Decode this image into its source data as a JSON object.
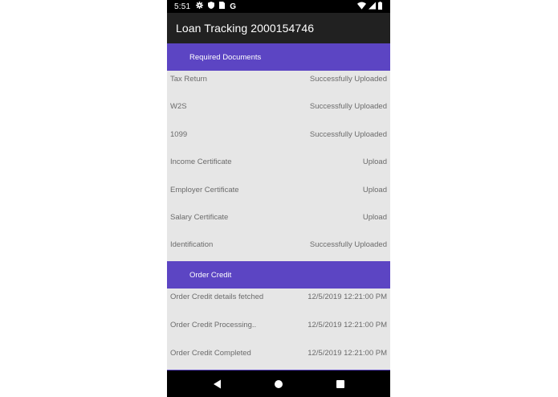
{
  "status_bar": {
    "time": "5:51",
    "icons_left": [
      "gear-icon",
      "shield-icon",
      "sim-icon",
      "google-icon"
    ],
    "icons_right": [
      "wifi-icon",
      "signal-icon",
      "battery-icon"
    ],
    "google_glyph": "G"
  },
  "app_bar": {
    "title": "Loan Tracking 2000154746"
  },
  "sections": [
    {
      "header": "Required Documents",
      "rows": [
        {
          "label": "Tax Return",
          "value": "Successfully Uploaded"
        },
        {
          "label": "W2S",
          "value": "Successfully Uploaded"
        },
        {
          "label": "1099",
          "value": "Successfully Uploaded"
        },
        {
          "label": "Income Certificate",
          "value": "Upload"
        },
        {
          "label": "Employer Certificate",
          "value": "Upload"
        },
        {
          "label": "Salary Certificate",
          "value": "Upload"
        },
        {
          "label": "Identification",
          "value": "Successfully Uploaded"
        }
      ]
    },
    {
      "header": "Order Credit",
      "rows": [
        {
          "label": "Order Credit details fetched",
          "value": "12/5/2019 12:21:00 PM"
        },
        {
          "label": "Order Credit Processing..",
          "value": "12/5/2019 12:21:00 PM"
        },
        {
          "label": "Order Credit Completed",
          "value": "12/5/2019 12:21:00 PM"
        }
      ]
    }
  ],
  "nav_bar": {
    "buttons": [
      "back-icon",
      "home-icon",
      "recents-icon"
    ]
  },
  "colors": {
    "section_header": "#5c45c3",
    "app_bar": "#212121",
    "content_bg": "#e6e6e6",
    "row_text": "#6b6b6b"
  }
}
